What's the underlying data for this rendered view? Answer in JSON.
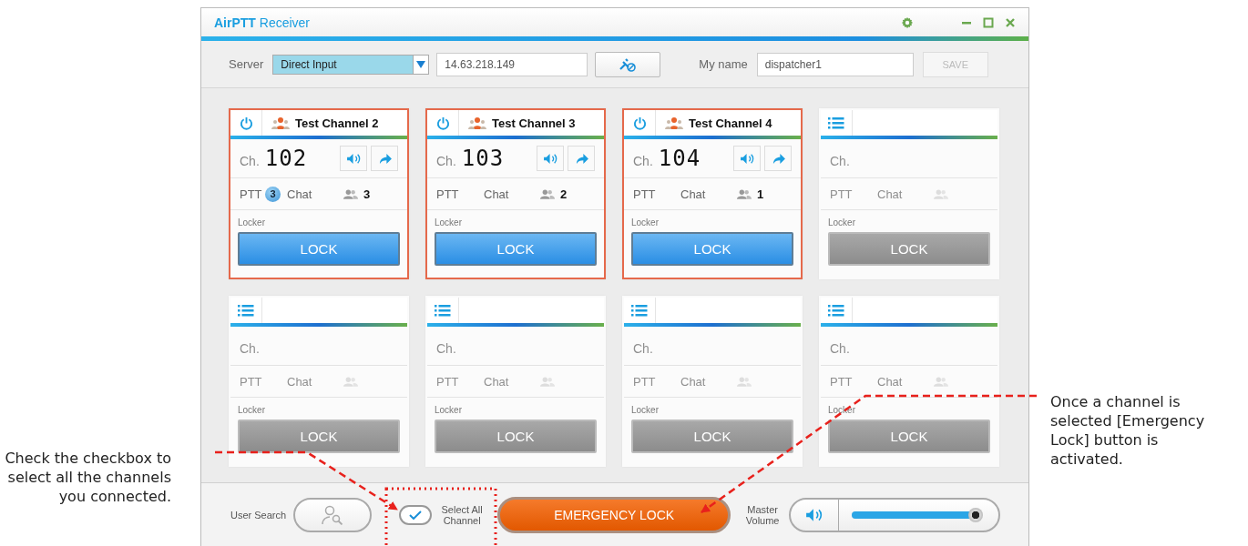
{
  "window": {
    "title": "**AirPTT** Receiver"
  },
  "toolbar": {
    "server_label": "Server",
    "server_value": "Direct Input",
    "address": "14.63.218.149",
    "name_label": "My name",
    "name": "dispatcher1",
    "save": "SAVE",
    "save_disabled": true
  },
  "channels": [
    {
      "kind": "active",
      "selected": true,
      "name": "Test Channel 2",
      "ch_label": "Ch.",
      "number": "102",
      "ptt": "PTT",
      "ptt_badge": "3",
      "chat": "Chat",
      "members": "3",
      "locker": "Locker",
      "lock": "LOCK"
    },
    {
      "kind": "active",
      "selected": true,
      "name": "Test Channel 3",
      "ch_label": "Ch.",
      "number": "103",
      "ptt": "PTT",
      "chat": "Chat",
      "members": "2",
      "locker": "Locker",
      "lock": "LOCK"
    },
    {
      "kind": "active",
      "selected": true,
      "name": "Test Channel 4",
      "ch_label": "Ch.",
      "number": "104",
      "ptt": "PTT",
      "chat": "Chat",
      "members": "1",
      "locker": "Locker",
      "lock": "LOCK"
    },
    {
      "kind": "empty",
      "selected": false,
      "ch_label": "Ch.",
      "ptt": "PTT",
      "chat": "Chat",
      "locker": "Locker",
      "lock": "LOCK"
    },
    {
      "kind": "empty",
      "selected": false,
      "ch_label": "Ch.",
      "ptt": "PTT",
      "chat": "Chat",
      "locker": "Locker",
      "lock": "LOCK"
    },
    {
      "kind": "empty",
      "selected": false,
      "ch_label": "Ch.",
      "ptt": "PTT",
      "chat": "Chat",
      "locker": "Locker",
      "lock": "LOCK"
    },
    {
      "kind": "empty",
      "selected": false,
      "ch_label": "Ch.",
      "ptt": "PTT",
      "chat": "Chat",
      "locker": "Locker",
      "lock": "LOCK"
    },
    {
      "kind": "empty",
      "selected": false,
      "ch_label": "Ch.",
      "ptt": "PTT",
      "chat": "Chat",
      "locker": "Locker",
      "lock": "LOCK"
    }
  ],
  "bottom": {
    "user_search": "User Search",
    "select_all": {
      "label": "Select All Channel",
      "checked": true
    },
    "emergency": "EMERGENCY LOCK",
    "volume_label": "Master Volume",
    "volume": {
      "level": 0.97
    }
  },
  "annotations": [
    {
      "text": "Check the checkbox to select all the channels you connected."
    },
    {
      "text": "Once a channel is selected [Emergency Lock] button is activated."
    }
  ]
}
